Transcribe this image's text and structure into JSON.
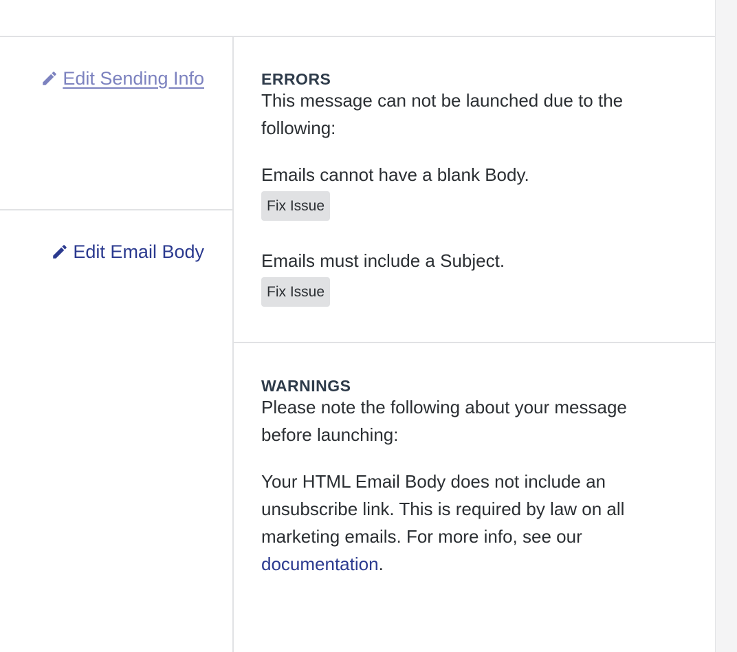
{
  "sidebar": {
    "edit_sending_label": "Edit Sending Info",
    "edit_body_label": "Edit Email Body"
  },
  "errors": {
    "heading": "ERRORS",
    "intro": "This message can not be launched due to the following:",
    "items": [
      {
        "text": "Emails cannot have a blank Body.",
        "button": "Fix Issue"
      },
      {
        "text": "Emails must include a Subject.",
        "button": "Fix Issue"
      }
    ]
  },
  "warnings": {
    "heading": "WARNINGS",
    "intro": "Please note the following about your message before launching:",
    "detail_text": "Your HTML Email Body does not include an unsubscribe link. This is required by law on all marketing emails. For more info, see our ",
    "link_text": "documentation",
    "trailing": "."
  },
  "colors": {
    "link": "#2b3a8f",
    "link_muted": "#7c82bf",
    "button_bg": "#e0e1e3",
    "divider": "#e1e2e4"
  }
}
